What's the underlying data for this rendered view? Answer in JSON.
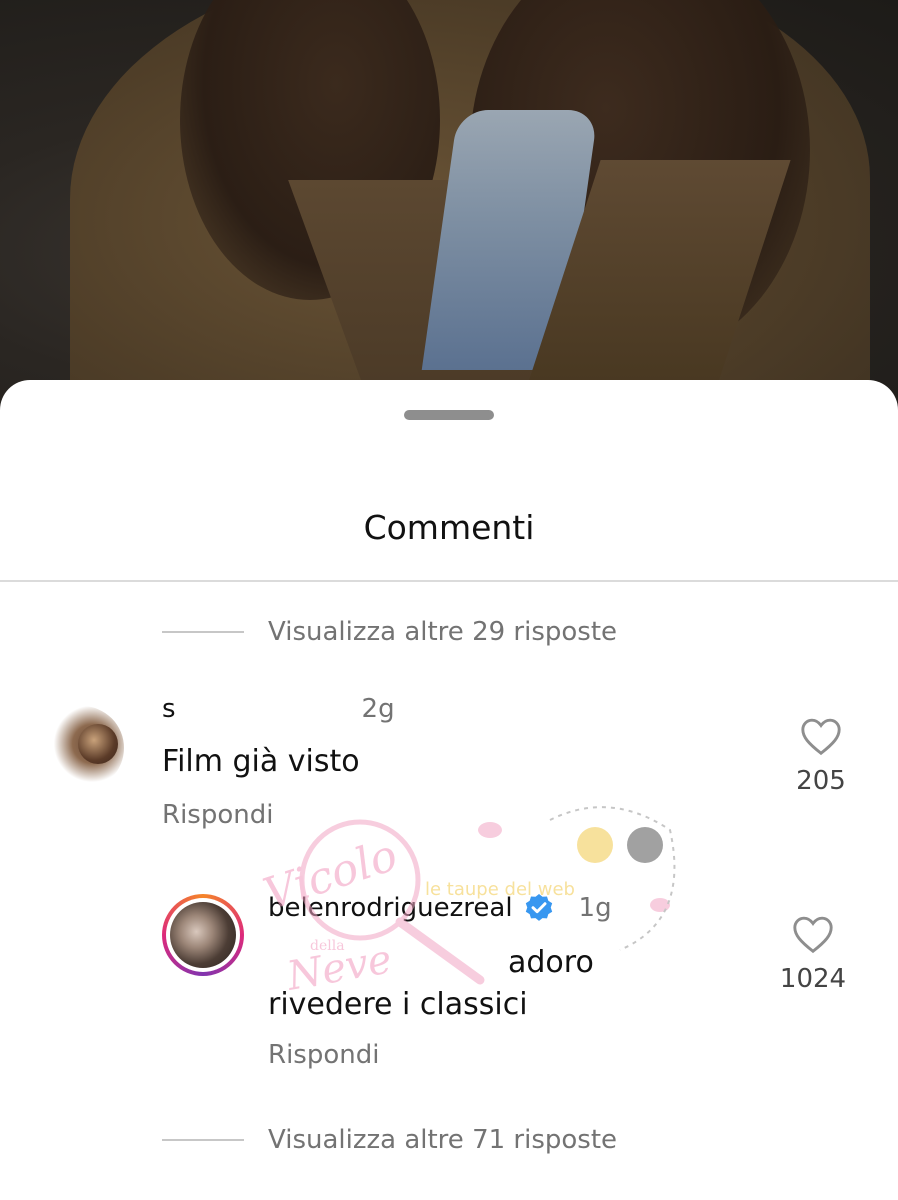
{
  "sheet": {
    "title": "Commenti"
  },
  "threads": [
    {
      "more_replies_label": "Visualizza altre 29 risposte"
    },
    {
      "more_replies_label": "Visualizza altre 71 risposte"
    }
  ],
  "comment_1": {
    "username_visible": "s",
    "time": "2g",
    "text": "Film già visto",
    "reply_label": "Rispondi",
    "likes": "205",
    "like_icon": "heart-outline-icon"
  },
  "comment_2": {
    "username": "belenrodriguezreal",
    "verified_icon": "verified-badge-icon",
    "time": "1g",
    "text_after_mention": "adoro rivedere i classici",
    "reply_label": "Rispondi",
    "likes": "1024",
    "like_icon": "heart-outline-icon"
  },
  "watermark": {
    "line1": "Vicolo",
    "line2": "della",
    "line3": "Neve",
    "tagline": "le taupe del web"
  },
  "colors": {
    "verified": "#3897f0",
    "secondary_text": "#737373",
    "story_ring_start": "#f58529",
    "story_ring_end": "#8134af"
  }
}
